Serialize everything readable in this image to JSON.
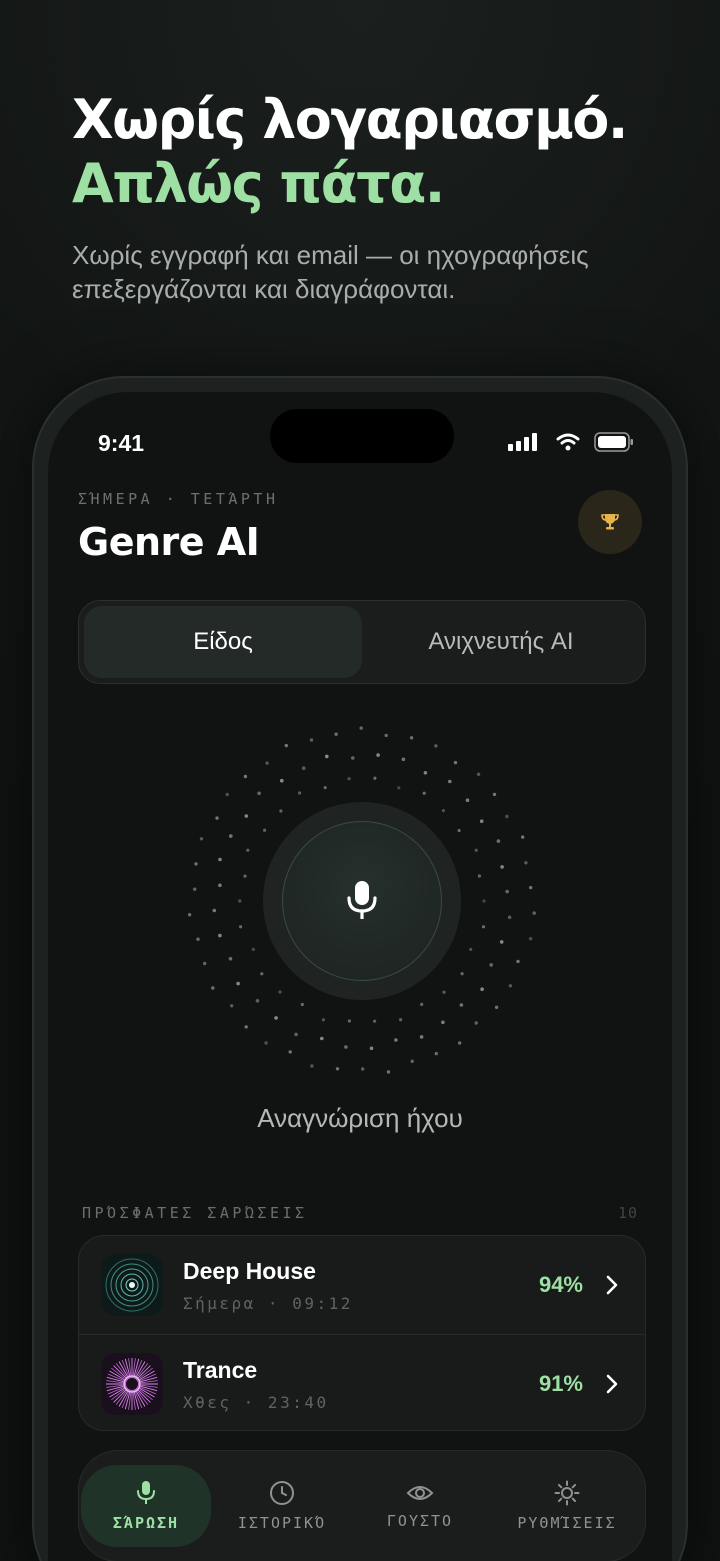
{
  "hero": {
    "title_line1": "Χωρίς λογαριασμό.",
    "title_line2": "Απλώς πάτα.",
    "subtitle": "Χωρίς εγγραφή και email — οι ηχογραφήσεις επεξεργάζονται και διαγράφονται."
  },
  "status_bar": {
    "time": "9:41",
    "icons": [
      "signal-icon",
      "wifi-icon",
      "battery-icon"
    ]
  },
  "header": {
    "dateline": "ΣΉΜΕΡΑ · ΤΕΤΆΡΤΗ",
    "app_title": "Genre AI",
    "trophy_icon": "trophy-icon"
  },
  "segmented": {
    "options": [
      "Είδος",
      "Ανιχνευτής AI"
    ],
    "selected": "Είδος"
  },
  "scanner": {
    "button_icon": "microphone-icon",
    "label": "Αναγνώριση ήχου"
  },
  "recent": {
    "heading": "ΠΡΌΣΦΑΤΕΣ ΣΑΡΏΣΕΙΣ",
    "count": "10",
    "items": [
      {
        "title": "Deep House",
        "subtitle": "Σήμερα · 09:12",
        "confidence": "94%",
        "thumb_color": "#5fb8b0"
      },
      {
        "title": "Trance",
        "subtitle": "Χθες · 23:40",
        "confidence": "91%",
        "thumb_color": "#b45cc8"
      }
    ]
  },
  "tabs": [
    {
      "label": "ΣΆΡΩΣΗ",
      "icon": "microphone-icon",
      "active": true
    },
    {
      "label": "ΙΣΤΟΡΙΚΌ",
      "icon": "clock-icon",
      "active": false
    },
    {
      "label": "ΓΟΥΣΤΟ",
      "icon": "eye-icon",
      "active": false
    },
    {
      "label": "ΡΥΘΜΊΣΕΙΣ",
      "icon": "sun-icon",
      "active": false
    }
  ],
  "colors": {
    "accent": "#9ee0a4",
    "background": "#111312",
    "trophy": "#e8b24a"
  }
}
